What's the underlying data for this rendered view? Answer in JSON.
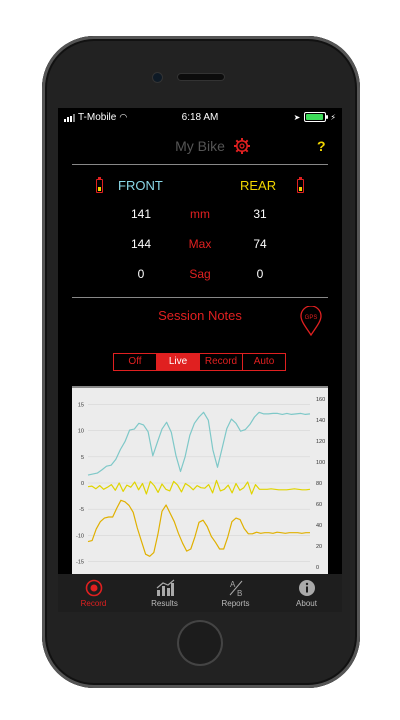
{
  "status": {
    "carrier": "T-Mobile",
    "time": "6:18 AM"
  },
  "header": {
    "title": "My Bike",
    "help": "?"
  },
  "sensors": {
    "front_label": "FRONT",
    "rear_label": "REAR",
    "rows": [
      {
        "front": "141",
        "label": "mm",
        "rear": "31"
      },
      {
        "front": "144",
        "label": "Max",
        "rear": "74"
      },
      {
        "front": "0",
        "label": "Sag",
        "rear": "0"
      }
    ]
  },
  "session": {
    "notes_label": "Session Notes",
    "gps_label": "GPS"
  },
  "modes": {
    "items": [
      "Off",
      "Live",
      "Record",
      "Auto"
    ],
    "selected": "Live"
  },
  "chart_data": {
    "type": "line",
    "left_ticks": [
      "15",
      "10",
      "5",
      "0",
      "-5",
      "-10",
      "-15"
    ],
    "right_ticks": [
      "160",
      "140",
      "120",
      "100",
      "80",
      "60",
      "40",
      "20",
      "0"
    ],
    "ylim_left": [
      -17,
      17
    ],
    "series": [
      {
        "color": "#7ec8c8",
        "values": [
          1.5,
          1.7,
          1.9,
          2.5,
          3.2,
          3.4,
          4.5,
          6.4,
          7.9,
          10.1,
          10.3,
          11.4,
          11.1,
          9.8,
          5.2,
          7.8,
          10.3,
          11.6,
          9.7,
          5.3,
          2.2,
          5.0,
          9.1,
          11.4,
          12.6,
          13.5,
          12.0,
          6.3,
          3.0,
          6.6,
          10.4,
          12.2,
          11.4,
          9.9,
          10.2,
          11.2,
          12.6,
          13.5,
          13.2,
          13.2,
          13.3,
          13.3,
          13.1,
          13.3,
          13.1,
          13.2,
          13.3,
          13.1,
          13.2
        ]
      },
      {
        "color": "#e0d400",
        "values": [
          -0.7,
          -0.6,
          -1.1,
          -0.5,
          -1.2,
          -0.8,
          -0.3,
          -1.4,
          0.0,
          -1.6,
          -0.4,
          -0.8,
          0.2,
          -1.3,
          -0.1,
          -2.1,
          0.3,
          -0.5,
          -1.8,
          -0.2,
          -1.2,
          -1.5,
          0.3,
          -0.4,
          -1.7,
          -0.1,
          -0.6,
          -1.3,
          -0.5,
          -0.9,
          -1.0,
          -0.3,
          -1.9,
          0.5,
          -1.5,
          -1.2,
          -0.4,
          -1.9,
          -0.1,
          -1.4,
          -0.9,
          0.2,
          -2.1,
          -0.3,
          -1.2,
          -1.2,
          -1.2,
          -1.1,
          -1.2,
          -1.3,
          -1.3,
          -1.3,
          -1.2,
          -1.1,
          -1.2,
          -1.3,
          -1.3,
          -1.2
        ]
      },
      {
        "color": "#e0b000",
        "values": [
          -11.2,
          -11.0,
          -8.8,
          -7.4,
          -6.7,
          -6.5,
          -6.5,
          -4.8,
          -3.3,
          -3.6,
          -4.3,
          -5.6,
          -8.6,
          -11.1,
          -13.6,
          -14.0,
          -13.3,
          -9.8,
          -5.4,
          -4.2,
          -5.8,
          -7.4,
          -9.6,
          -11.5,
          -13.0,
          -12.6,
          -10.3,
          -7.5,
          -7.1,
          -8.3,
          -10.2,
          -11.3,
          -12.6,
          -12.6,
          -10.3,
          -7.4,
          -6.7,
          -7.0,
          -8.7,
          -9.7,
          -9.7,
          -9.4,
          -9.6,
          -9.5,
          -9.5,
          -9.6,
          -9.4,
          -9.5,
          -9.6,
          -9.5,
          -9.5,
          -9.5,
          -9.6,
          -9.5,
          -9.5
        ]
      }
    ]
  },
  "tabs": [
    {
      "label": "Record",
      "icon": "record-icon"
    },
    {
      "label": "Results",
      "icon": "results-icon"
    },
    {
      "label": "Reports",
      "icon": "ab-compare-icon"
    },
    {
      "label": "About",
      "icon": "info-icon"
    }
  ],
  "colors": {
    "accent": "#e02020",
    "front": "#8ad8e8",
    "rear": "#f1d500"
  }
}
